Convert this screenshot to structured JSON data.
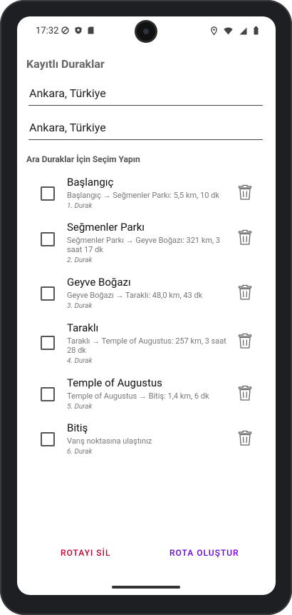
{
  "status": {
    "time": "17:32"
  },
  "page": {
    "title": "Kayıtlı Duraklar",
    "start_field": "Ankara, Türkiye",
    "end_field": "Ankara, Türkiye",
    "section_title": "Ara Duraklar İçin Seçim Yapın"
  },
  "stops": [
    {
      "name": "Başlangıç",
      "route": "Başlangıç → Seğmenler Parkı: 5,5 km, 10 dk",
      "order": "1. Durak"
    },
    {
      "name": "Seğmenler Parkı",
      "route": "Seğmenler Parkı → Geyve Boğazı: 321 km, 3 saat 17 dk",
      "order": "2. Durak"
    },
    {
      "name": "Geyve Boğazı",
      "route": "Geyve Boğazı → Taraklı: 48,0 km, 43 dk",
      "order": "3. Durak"
    },
    {
      "name": "Taraklı",
      "route": "Taraklı → Temple of Augustus: 257 km, 3 saat 28 dk",
      "order": "4. Durak"
    },
    {
      "name": "Temple of Augustus",
      "route": "Temple of Augustus → Bitiş: 1,4 km, 6 dk",
      "order": "5. Durak"
    },
    {
      "name": "Bitiş",
      "route": "Varış noktasına ulaştınız",
      "order": "6. Durak"
    }
  ],
  "actions": {
    "delete_label": "ROTAYI SİL",
    "create_label": "ROTA OLUŞTUR",
    "delete_color": "#c2002b",
    "create_color": "#6a00d8"
  },
  "icons": {
    "status_left": [
      "do-not-disturb-icon",
      "shield-icon",
      "sd-card-icon"
    ],
    "status_right": [
      "location-icon",
      "wifi-icon",
      "signal-icon",
      "battery-icon"
    ],
    "stop_checkbox": "checkbox-icon",
    "stop_delete": "trash-icon"
  }
}
